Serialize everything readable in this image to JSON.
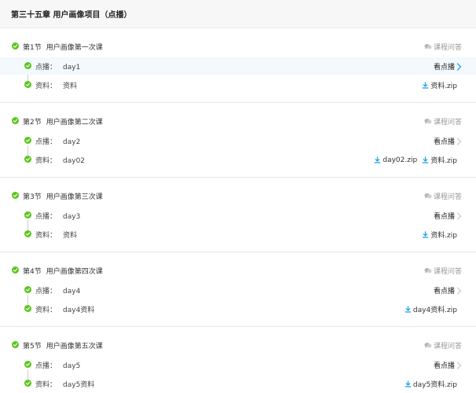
{
  "chapter": {
    "title": "第三十五章 用户画像项目（点播）"
  },
  "labels": {
    "qa": "课程问答",
    "watch": "看点播",
    "vod_prefix": "点播：",
    "material_prefix": "资料："
  },
  "colors": {
    "check": "#5cc51d",
    "download": "#29a9e6",
    "active_row": "#f3f9fd"
  },
  "sections": [
    {
      "num": "第1节",
      "name": "用户画像第一次课",
      "vod": "day1",
      "material": "资料",
      "downloads": [
        "资料.zip"
      ],
      "active": true
    },
    {
      "num": "第2节",
      "name": "用户画像第二次课",
      "vod": "day2",
      "material": "day02",
      "downloads": [
        "day02.zip",
        "资料.zip"
      ],
      "active": false
    },
    {
      "num": "第3节",
      "name": "用户画像第三次课",
      "vod": "day3",
      "material": "资料",
      "downloads": [
        "资料.zip"
      ],
      "active": false
    },
    {
      "num": "第4节",
      "name": "用户画像第四次课",
      "vod": "day4",
      "material": "day4资料",
      "downloads": [
        "day4资料.zip"
      ],
      "active": false
    },
    {
      "num": "第5节",
      "name": "用户画像第五次课",
      "vod": "day5",
      "material": "day5资料",
      "downloads": [
        "day5资料.zip"
      ],
      "active": false
    }
  ]
}
